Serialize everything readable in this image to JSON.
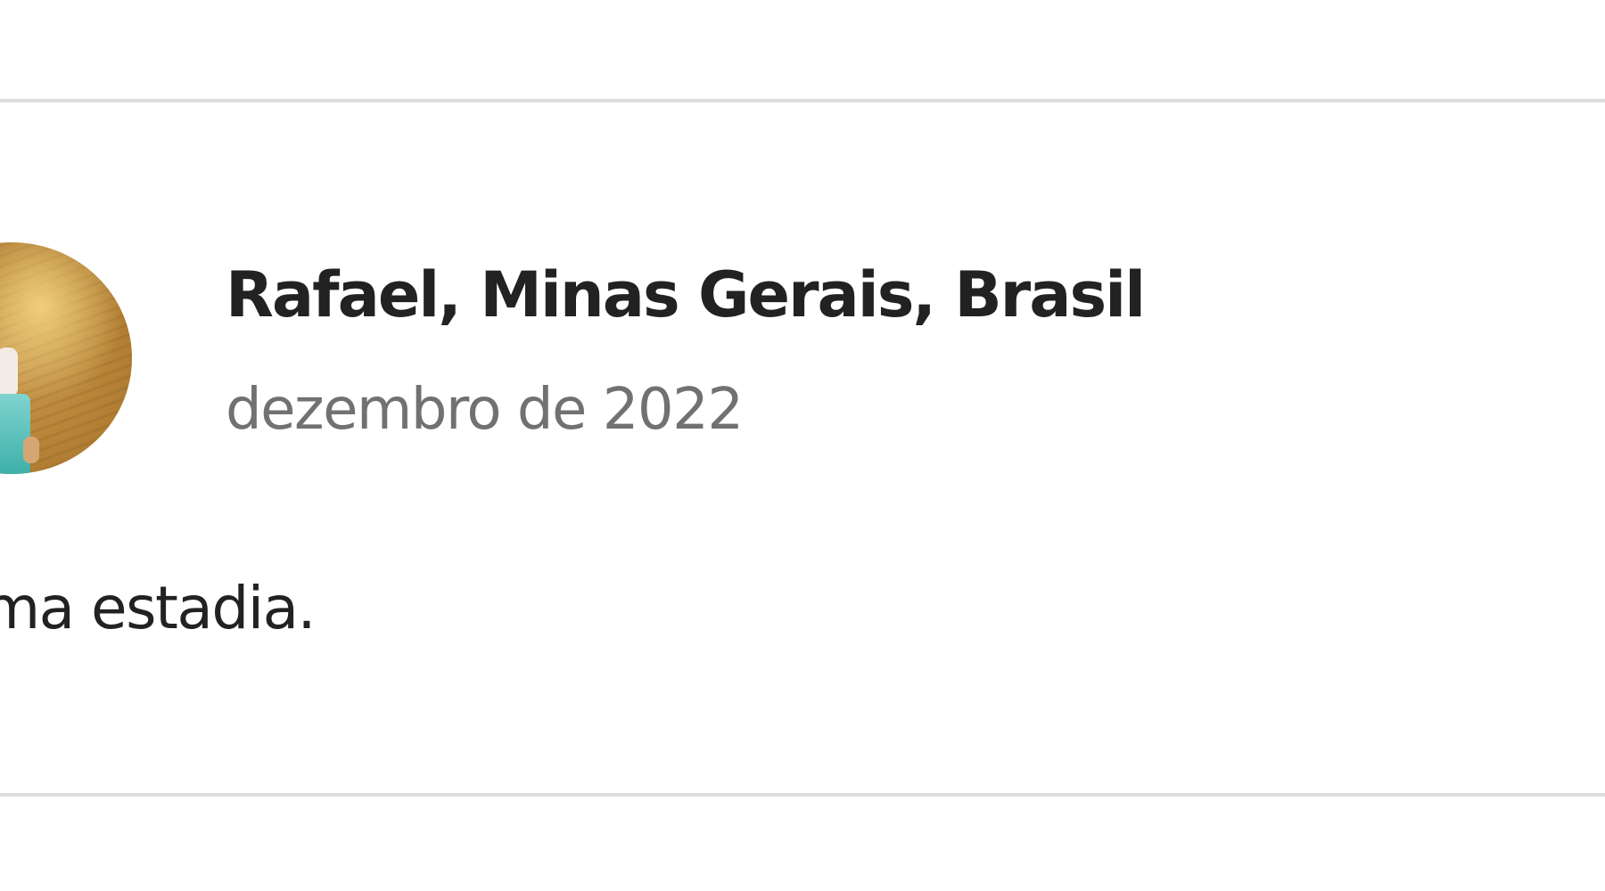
{
  "review": {
    "reviewer_name": "Rafael, Minas Gerais, Brasil",
    "date": "dezembro de 2022",
    "text": "ima estadia."
  },
  "colors": {
    "name_text": "#222222",
    "date_text": "#717171",
    "divider": "#dddddd",
    "background": "#ffffff"
  }
}
